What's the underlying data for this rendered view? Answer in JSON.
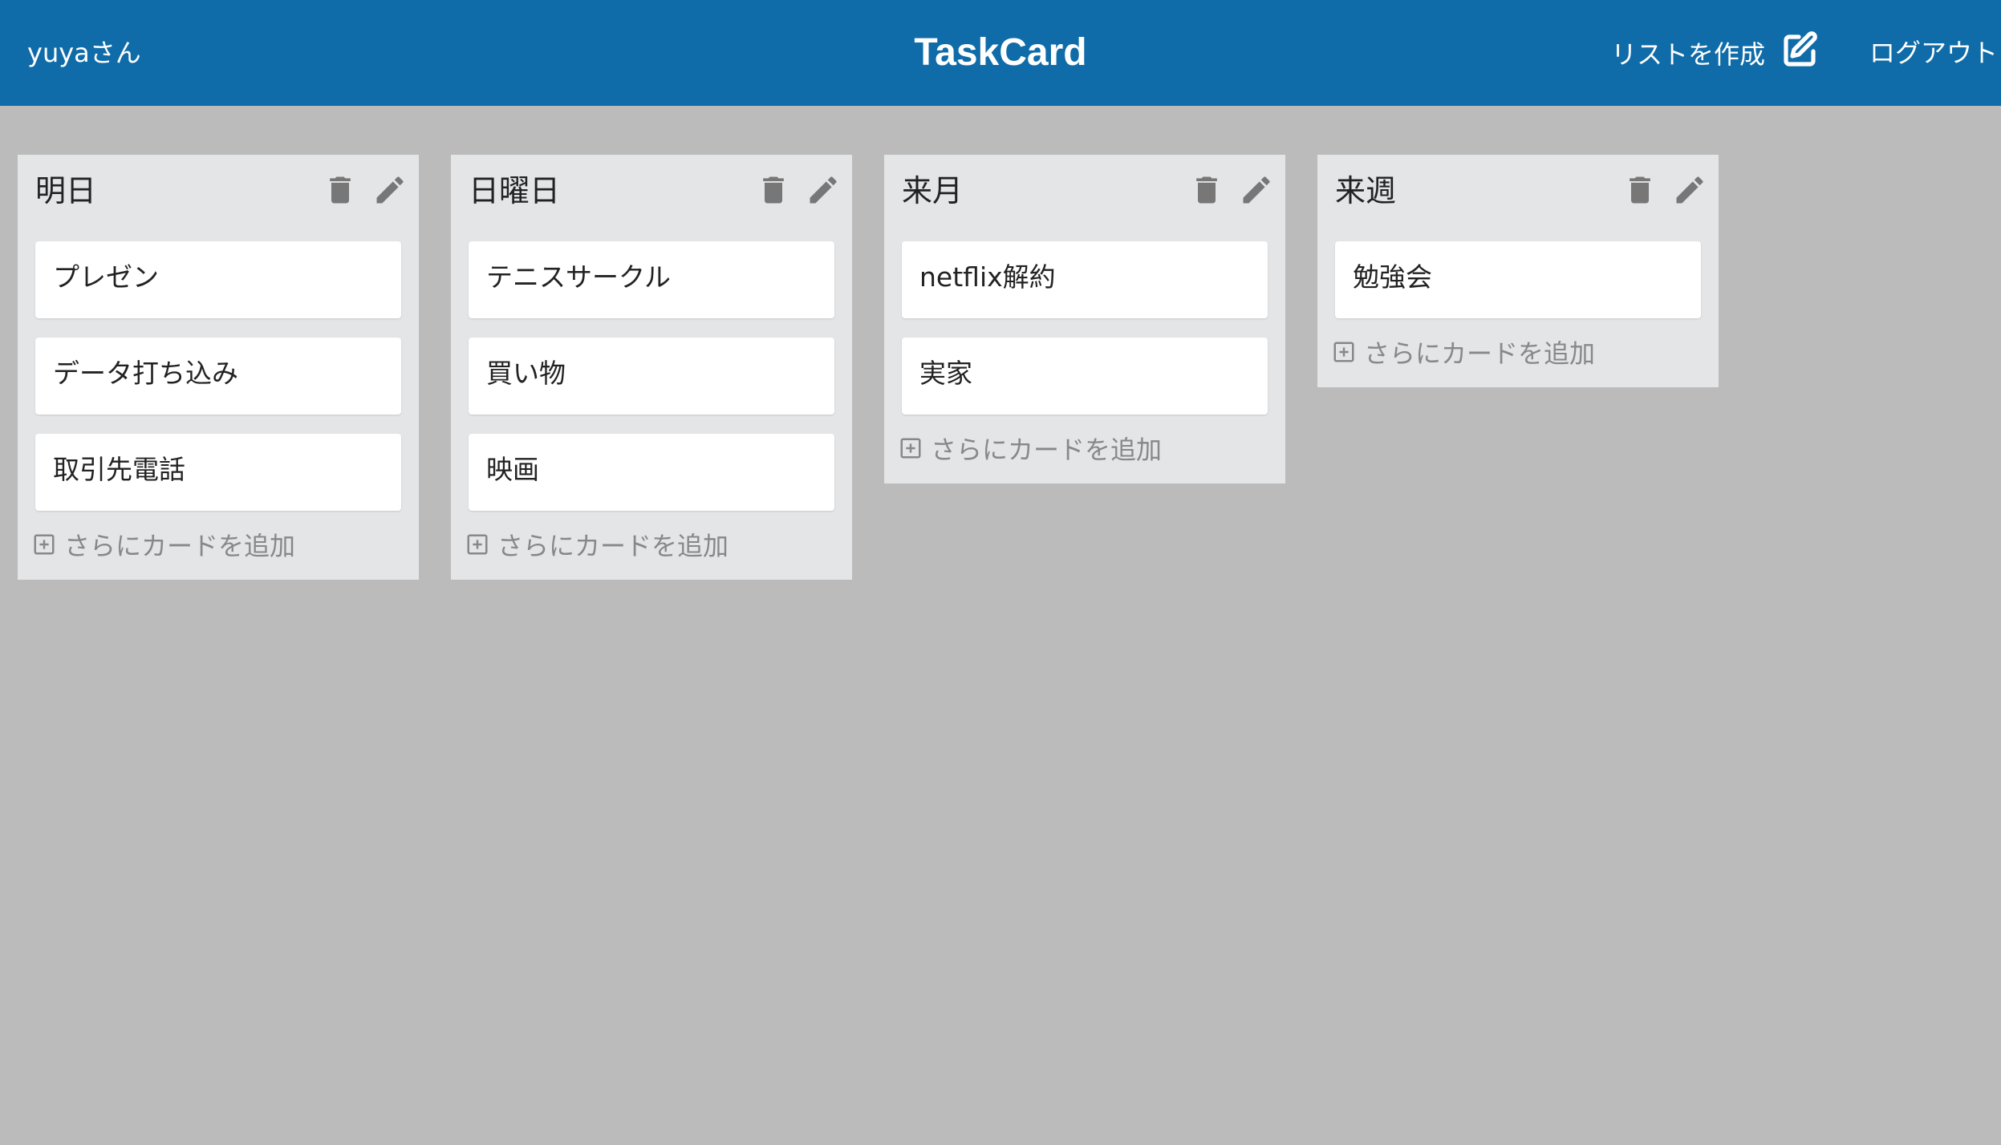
{
  "header": {
    "user_name": "yuyaさん",
    "app_title": "TaskCard",
    "create_list_label": "リストを作成",
    "create_list_icon": "edit-square-icon",
    "logout_label": "ログアウト",
    "background_color": "#0f6ca8"
  },
  "board": {
    "background_color": "#bbbbbb",
    "add_card_label": "さらにカードを追加",
    "lists": [
      {
        "title": "明日",
        "cards": [
          "プレゼン",
          "データ打ち込み",
          "取引先電話"
        ]
      },
      {
        "title": "日曜日",
        "cards": [
          "テニスサークル",
          "買い物",
          "映画"
        ]
      },
      {
        "title": "来月",
        "cards": [
          "netflix解約",
          "実家"
        ]
      },
      {
        "title": "来週",
        "cards": [
          "勉強会"
        ]
      }
    ]
  }
}
